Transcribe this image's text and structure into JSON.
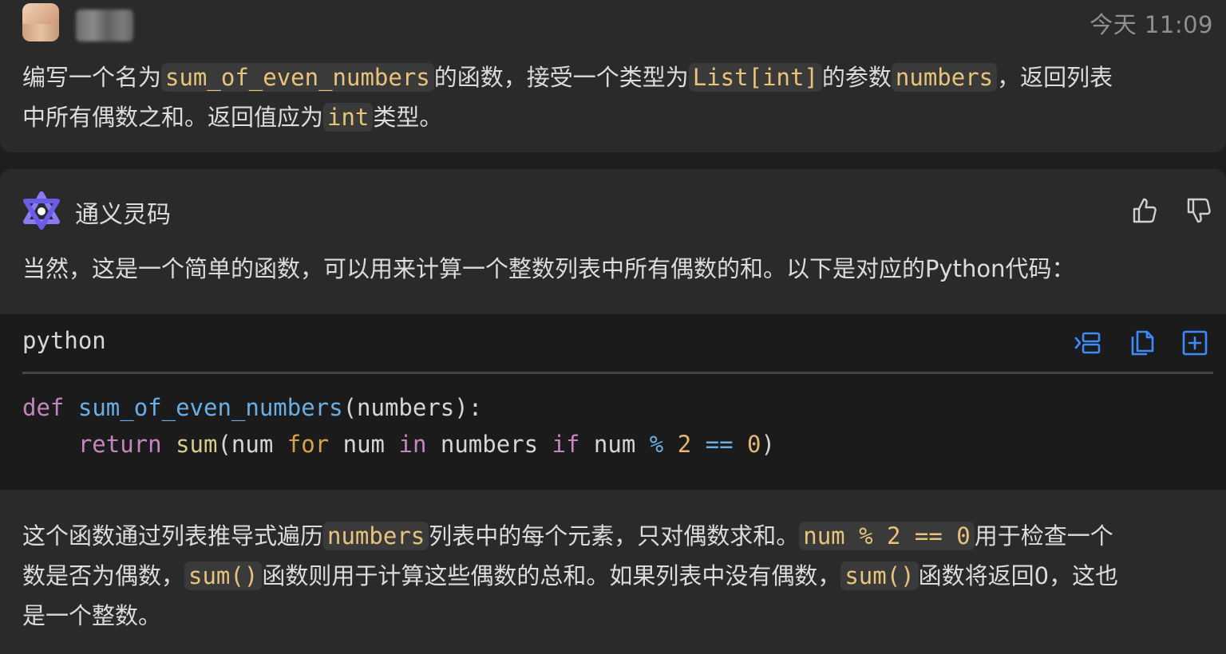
{
  "user_message": {
    "timestamp": "今天 11:09",
    "line1_parts": [
      "编写一个名为",
      "sum_of_even_numbers",
      "的函数，接受一个类型为",
      "List[int]",
      "的参数",
      "numbers",
      "，返回列表"
    ],
    "line2_parts": [
      "中所有偶数之和。返回值应为",
      "int",
      "类型。"
    ]
  },
  "ai_message": {
    "name": "通义灵码",
    "intro": "当然，这是一个简单的函数，可以用来计算一个整数列表中所有偶数的和。以下是对应的Python代码：",
    "code": {
      "language": "python",
      "line1": {
        "def": "def",
        "fname": "sum_of_even_numbers",
        "params": "(numbers):"
      },
      "line2": {
        "indent": "    ",
        "return": "return",
        "sum": "sum",
        "open": "(num ",
        "for": "for",
        "num2": " num ",
        "in": "in",
        "numbers": " numbers ",
        "if": "if",
        "num3": " num ",
        "mod": "%",
        "two": "2",
        "eq": "==",
        "zero": "0",
        "close": ")"
      }
    },
    "explain_line1_parts": [
      "这个函数通过列表推导式遍历",
      "numbers",
      "列表中的每个元素，只对偶数求和。",
      "num % 2 == 0",
      "用于检查一个"
    ],
    "explain_line2_parts": [
      "数是否为偶数，",
      "sum()",
      "函数则用于计算这些偶数的总和。如果列表中没有偶数，",
      "sum()",
      "函数将返回0，这也"
    ],
    "explain_line3": "是一个整数。"
  },
  "icons": {
    "logo": "tongyi-logo-icon",
    "like": "thumbs-up-icon",
    "dislike": "thumbs-down-icon",
    "insert": "insert-code-icon",
    "copy": "copy-icon",
    "new_file": "new-file-icon"
  },
  "colors": {
    "accent": "#3d8bfd",
    "inline_code": "#e8c47a",
    "keyword": "#c586c0",
    "function": "#6aaee6"
  }
}
